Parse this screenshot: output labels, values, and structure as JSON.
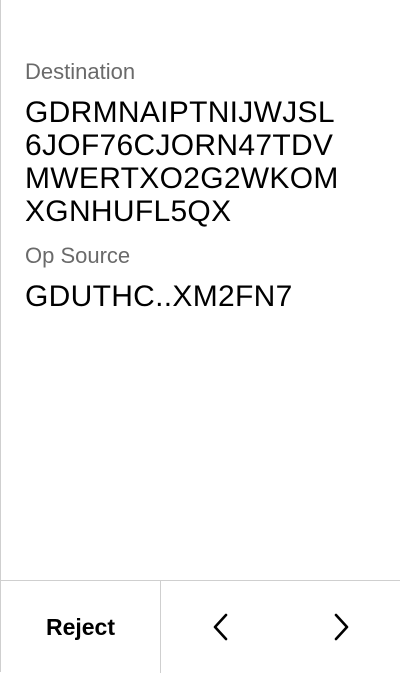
{
  "fields": [
    {
      "label": "Destination",
      "lines": [
        "GDRMNAIPTNIJWJSL",
        "6JOF76CJORN47TDV",
        "MWERTXO2G2WKOM",
        "XGNHUFL5QX"
      ]
    },
    {
      "label": "Op Source",
      "lines": [
        "GDUTHC..XM2FN7"
      ]
    }
  ],
  "footer": {
    "reject_label": "Reject",
    "prev_icon": "chevron-left-icon",
    "next_icon": "chevron-right-icon"
  }
}
